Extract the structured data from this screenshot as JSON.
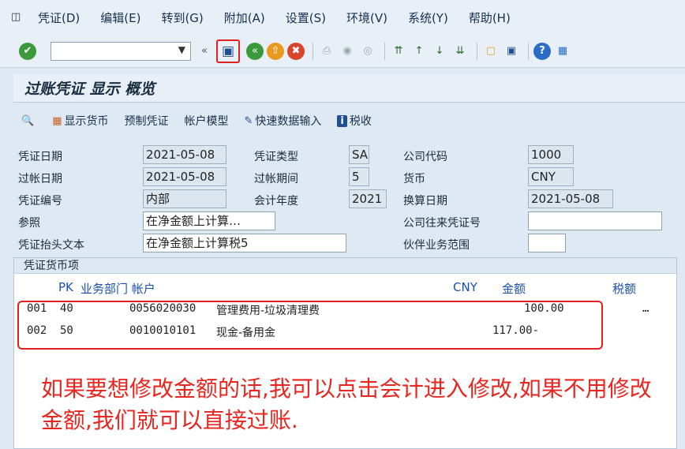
{
  "menu": [
    "凭证(D)",
    "编辑(E)",
    "转到(G)",
    "附加(A)",
    "设置(S)",
    "环境(V)",
    "系统(Y)",
    "帮助(H)"
  ],
  "toolbar": {
    "icons": [
      "enter-icon",
      "save-icon",
      "back-icon",
      "exit-icon",
      "cancel-icon",
      "print-icon",
      "find-icon",
      "find-next-icon",
      "first-page-icon",
      "prev-page-icon",
      "next-page-icon",
      "last-page-icon",
      "new-session-icon",
      "shortcut-icon",
      "help-icon",
      "layout-icon"
    ],
    "command_value": ""
  },
  "title": "过账凭证 显示 概览",
  "app_toolbar": [
    {
      "name": "display-currency",
      "label": "显示货币"
    },
    {
      "name": "park-document",
      "label": "预制凭证"
    },
    {
      "name": "account-model",
      "label": "帐户模型"
    },
    {
      "name": "fast-data-entry",
      "label": "快速数据输入"
    },
    {
      "name": "taxes",
      "label": "税收"
    }
  ],
  "header": {
    "doc_date_label": "凭证日期",
    "doc_date": "2021-05-08",
    "doc_type_label": "凭证类型",
    "doc_type": "SA",
    "company_code_label": "公司代码",
    "company_code": "1000",
    "posting_date_label": "过帐日期",
    "posting_date": "2021-05-08",
    "period_label": "过帐期间",
    "period": "5",
    "currency_label": "货币",
    "currency": "CNY",
    "doc_number_label": "凭证编号",
    "doc_number": "内部",
    "fiscal_year_label": "会计年度",
    "fiscal_year": "2021",
    "translation_date_label": "换算日期",
    "translation_date": "2021-05-08",
    "reference_label": "参照",
    "reference": "在净金额上计算…",
    "cross_cc_label": "公司往来凭证号",
    "cross_cc": "",
    "header_text_label": "凭证抬头文本",
    "header_text": "在净金额上计算税5",
    "trading_partner_label": "伙伴业务范围",
    "trading_partner": ""
  },
  "items": {
    "section_title": "凭证货币项",
    "col_pk": "PK",
    "col_dept_account": "业务部门 帐户",
    "col_currency": "CNY",
    "col_amount": "金额",
    "col_tax": "税额",
    "rows": [
      {
        "line": "001",
        "pk": "40",
        "account": "0056020030",
        "desc": "管理费用-垃圾清理费",
        "amount": "100.00",
        "tax": "…"
      },
      {
        "line": "002",
        "pk": "50",
        "account": "0010010101",
        "desc": "现金-备用金",
        "amount": "117.00-",
        "tax": ""
      }
    ]
  },
  "annotation": "如果要想修改金额的话,我可以点击会计进入修改,如果不用修改金额,我们就可以直接过账."
}
